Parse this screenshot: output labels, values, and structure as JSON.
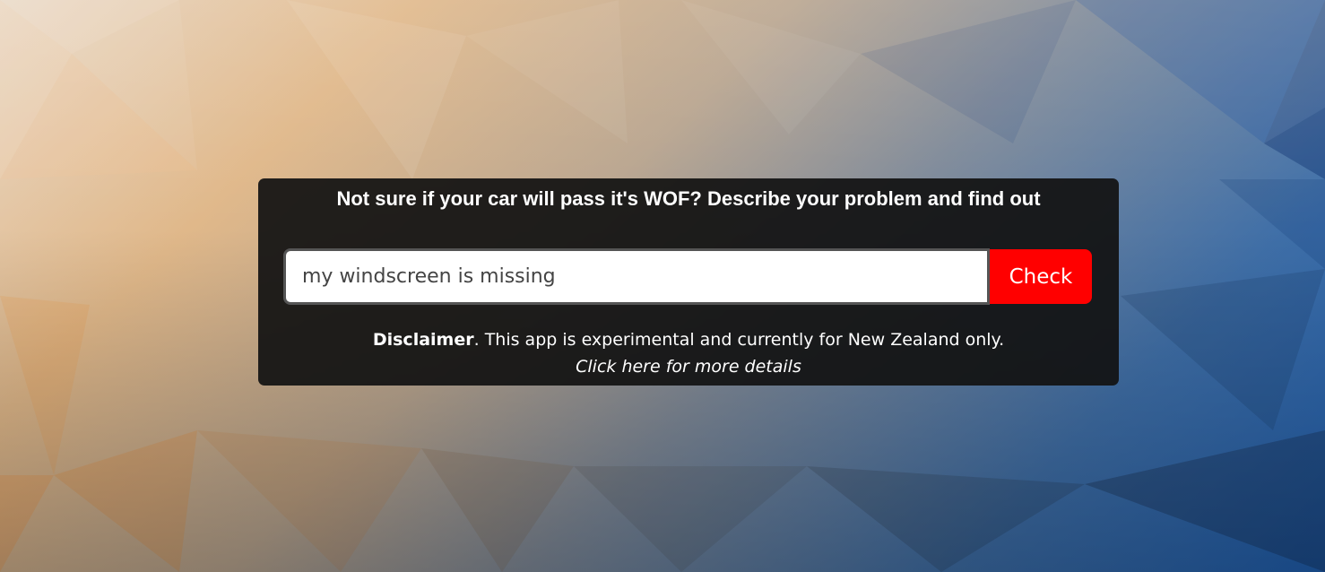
{
  "headline": "Not sure if your car will pass it's WOF? Describe your problem and find out",
  "search": {
    "value": "my windscreen is missing",
    "button_label": "Check"
  },
  "disclaimer": {
    "label": "Disclaimer",
    "text": ". This app is experimental and currently for New Zealand only.",
    "link_text": "Click here for more details"
  },
  "colors": {
    "button": "#ff0000",
    "panel": "#121212"
  }
}
